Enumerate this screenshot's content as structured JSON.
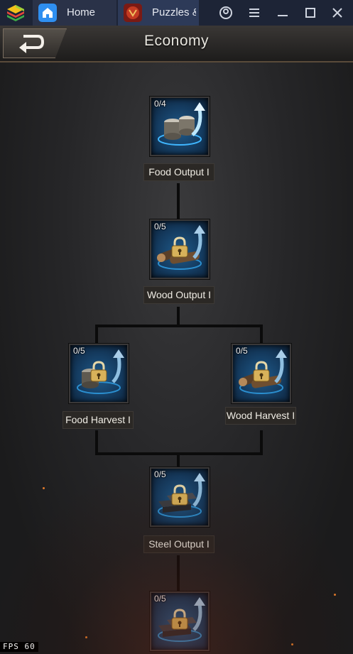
{
  "window": {
    "tabs": [
      {
        "label": "Home",
        "icon": "home-icon"
      },
      {
        "label": "Puzzles &",
        "icon": "game-icon"
      }
    ],
    "controls": [
      "account-icon",
      "menu-icon",
      "minimize-icon",
      "maximize-icon",
      "close-icon"
    ]
  },
  "header": {
    "title": "Economy",
    "back_icon": "back-arrow-icon"
  },
  "nodes": [
    {
      "label": "Food Output I",
      "level": "0/4",
      "locked": false,
      "icon": "food-output-icon"
    },
    {
      "label": "Wood Output I",
      "level": "0/5",
      "locked": true,
      "icon": "wood-output-icon"
    },
    {
      "label": "Food Harvest I",
      "level": "0/5",
      "locked": true,
      "icon": "food-harvest-icon"
    },
    {
      "label": "Wood Harvest I",
      "level": "0/5",
      "locked": true,
      "icon": "wood-harvest-icon"
    },
    {
      "label": "Steel Output I",
      "level": "0/5",
      "locked": true,
      "icon": "steel-output-icon"
    },
    {
      "label": "",
      "level": "0/5",
      "locked": true,
      "icon": "steel-upgrade-icon"
    }
  ],
  "fps": {
    "label": "FPS",
    "value": "60"
  },
  "colors": {
    "titlebar": "#1d2436",
    "node_glow": "#1f5a8a",
    "label_bg": "#2b2825"
  }
}
